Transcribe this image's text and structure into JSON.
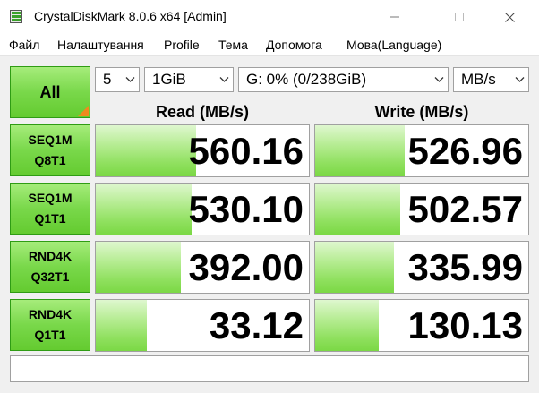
{
  "window": {
    "title": "CrystalDiskMark 8.0.6 x64 [Admin]",
    "minimize_icon": "minimize-icon",
    "maximize_icon": "maximize-icon",
    "close_icon": "close-icon",
    "close_glyph": "✕",
    "minimize_glyph": "—",
    "maximize_glyph": "☐"
  },
  "menu": {
    "items": [
      "Файл",
      "Налаштування",
      "Profile",
      "Тема",
      "Допомога",
      "Мова(Language)"
    ]
  },
  "controls": {
    "all_label": "All",
    "count": "5",
    "size": "1GiB",
    "drive": "G: 0% (0/238GiB)",
    "unit": "MB/s"
  },
  "headers": {
    "read": "Read (MB/s)",
    "write": "Write (MB/s)"
  },
  "tests": [
    {
      "line1": "SEQ1M",
      "line2": "Q8T1",
      "read": "560.16",
      "write": "526.96",
      "read_fill": 0.47,
      "write_fill": 0.42
    },
    {
      "line1": "SEQ1M",
      "line2": "Q1T1",
      "read": "530.10",
      "write": "502.57",
      "read_fill": 0.45,
      "write_fill": 0.4
    },
    {
      "line1": "RND4K",
      "line2": "Q32T1",
      "read": "392.00",
      "write": "335.99",
      "read_fill": 0.4,
      "write_fill": 0.37
    },
    {
      "line1": "RND4K",
      "line2": "Q1T1",
      "read": "33.12",
      "write": "130.13",
      "read_fill": 0.24,
      "write_fill": 0.3
    }
  ],
  "colors": {
    "button_green": "#79d84a",
    "bar_green": "#8fe05e",
    "corner_orange": "#f08a1c"
  },
  "status_text": ""
}
